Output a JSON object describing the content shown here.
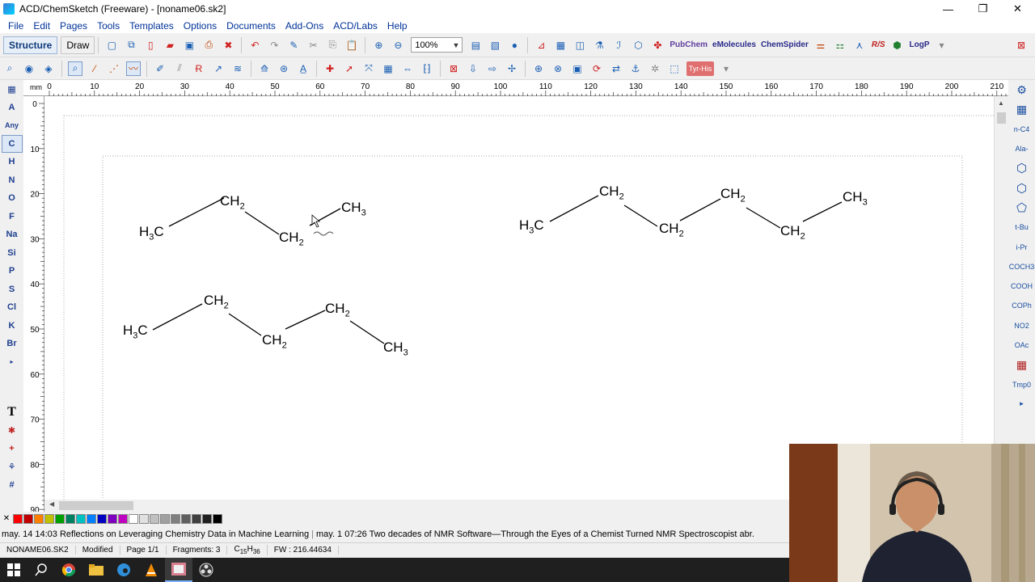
{
  "window": {
    "title": "ACD/ChemSketch (Freeware) - [noname06.sk2]",
    "minimize": "—",
    "restore": "❐",
    "close": "✕"
  },
  "menu": [
    "File",
    "Edit",
    "Pages",
    "Tools",
    "Templates",
    "Options",
    "Documents",
    "Add-Ons",
    "ACD/Labs",
    "Help"
  ],
  "toolbar": {
    "structure_label": "Structure",
    "draw_label": "Draw",
    "zoom_value": "100%",
    "logp_label": "LogP",
    "rs_label": "R/S",
    "pubchem_label": "PubChem",
    "emolecules_label": "eMolecules",
    "chemspider_label": "ChemSpider",
    "tyr_his_label": "Tyr-His"
  },
  "left_toolbar": [
    "A",
    "Any",
    "C",
    "H",
    "N",
    "O",
    "F",
    "Na",
    "Si",
    "P",
    "S",
    "Cl",
    "K",
    "Br"
  ],
  "right_toolbar": [
    "n-C4",
    "Ala-",
    "t-Bu",
    "i-Pr",
    "COCH3",
    "COOH",
    "COPh",
    "NO2",
    "OAc",
    "Tmp0"
  ],
  "ruler": {
    "unit": "mm",
    "h_ticks": [
      "0",
      "10",
      "20",
      "30",
      "40",
      "50",
      "60",
      "70",
      "80",
      "90",
      "100",
      "110",
      "120",
      "130",
      "140",
      "150",
      "160",
      "170",
      "180",
      "190",
      "200",
      "210"
    ],
    "v_ticks": [
      "0",
      "10",
      "20",
      "30",
      "40",
      "50",
      "60",
      "70",
      "80",
      "90"
    ]
  },
  "molecules": [
    {
      "name": "molecule-1",
      "labels": [
        {
          "main": "H",
          "sub": "3",
          "tail": "C"
        },
        {
          "main": "CH",
          "sub": "2",
          "tail": ""
        },
        {
          "main": "CH",
          "sub": "2",
          "tail": ""
        },
        {
          "main": "CH",
          "sub": "3",
          "tail": ""
        }
      ]
    },
    {
      "name": "molecule-2",
      "labels": [
        {
          "main": "H",
          "sub": "3",
          "tail": "C"
        },
        {
          "main": "CH",
          "sub": "2",
          "tail": ""
        },
        {
          "main": "CH",
          "sub": "2",
          "tail": ""
        },
        {
          "main": "CH",
          "sub": "2",
          "tail": ""
        },
        {
          "main": "CH",
          "sub": "2",
          "tail": ""
        },
        {
          "main": "CH",
          "sub": "3",
          "tail": ""
        }
      ]
    },
    {
      "name": "molecule-3",
      "labels": [
        {
          "main": "H",
          "sub": "3",
          "tail": "C"
        },
        {
          "main": "CH",
          "sub": "2",
          "tail": ""
        },
        {
          "main": "CH",
          "sub": "2",
          "tail": ""
        },
        {
          "main": "CH",
          "sub": "2",
          "tail": ""
        },
        {
          "main": "CH",
          "sub": "3",
          "tail": ""
        }
      ]
    }
  ],
  "palette_colors": [
    "#ff0000",
    "#c00000",
    "#ff8000",
    "#c0c000",
    "#00a000",
    "#008060",
    "#00c0c0",
    "#0080ff",
    "#0000c0",
    "#8000c0",
    "#c000c0",
    "#ffffff",
    "#e0e0e0",
    "#c0c0c0",
    "#a0a0a0",
    "#808080",
    "#606060",
    "#404040",
    "#202020",
    "#000000"
  ],
  "ticker": {
    "item1": "may. 14 14:03 Reflections on Leveraging Chemistry Data in Machine Learning",
    "item2": "may. 1 07:26 Two decades of NMR Software—Through the Eyes of a Chemist Turned NMR Spectroscopist",
    "item3": "abr."
  },
  "status": {
    "file": "NONAME06.SK2",
    "modified": "Modified",
    "page": "Page 1/1",
    "fragments": "Fragments: 3",
    "formula": "C15H36",
    "fw": "FW : 216.44634"
  }
}
